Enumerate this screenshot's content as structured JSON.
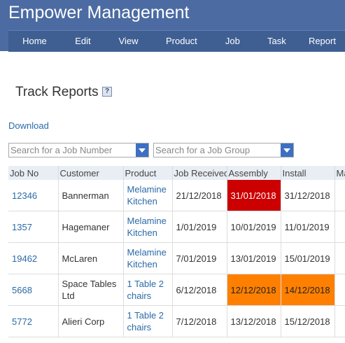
{
  "app": {
    "title": "Empower Management"
  },
  "nav": {
    "items": [
      "Home",
      "Edit",
      "View",
      "Product",
      "Job",
      "Task",
      "Report"
    ]
  },
  "page": {
    "title": "Track Reports",
    "help_icon": "?",
    "download_label": "Download"
  },
  "search": {
    "job_number_placeholder": "Search for a Job Number",
    "job_group_placeholder": "Search for a Job Group"
  },
  "table": {
    "headers": [
      "Job No",
      "Customer",
      "Product",
      "Job Received",
      "Assembly",
      "Install",
      "Ma"
    ],
    "rows": [
      {
        "job_no": "12346",
        "customer": "Bannerman",
        "product": "Melamine Kitchen",
        "received": "21/12/2018",
        "assembly": "31/01/2018",
        "install": "31/12/2018",
        "ma": "",
        "assembly_status": "red",
        "install_status": ""
      },
      {
        "job_no": "1357",
        "customer": "Hagemaner",
        "product": "Melamine Kitchen",
        "received": "1/01/2019",
        "assembly": "10/01/2019",
        "install": "11/01/2019",
        "ma": "",
        "assembly_status": "",
        "install_status": ""
      },
      {
        "job_no": "19462",
        "customer": "McLaren",
        "product": "Melamine Kitchen",
        "received": "7/01/2019",
        "assembly": "13/01/2019",
        "install": "15/01/2019",
        "ma": "",
        "assembly_status": "",
        "install_status": ""
      },
      {
        "job_no": "5668",
        "customer": "Space Tables Ltd",
        "product": "1 Table 2 chairs",
        "received": "6/12/2018",
        "assembly": "12/12/2018",
        "install": "14/12/2018",
        "ma": "",
        "assembly_status": "orange",
        "install_status": "orange"
      },
      {
        "job_no": "5772",
        "customer": "Alieri Corp",
        "product": "1 Table 2 chairs",
        "received": "7/12/2018",
        "assembly": "13/12/2018",
        "install": "15/12/2018",
        "ma": "",
        "assembly_status": "",
        "install_status": ""
      }
    ]
  },
  "colors": {
    "header_bg": "#4b6ba2",
    "nav_bg": "#3f5f93",
    "link": "#2a6aa8",
    "status_red": "#cc0000",
    "status_orange": "#ff8000"
  }
}
